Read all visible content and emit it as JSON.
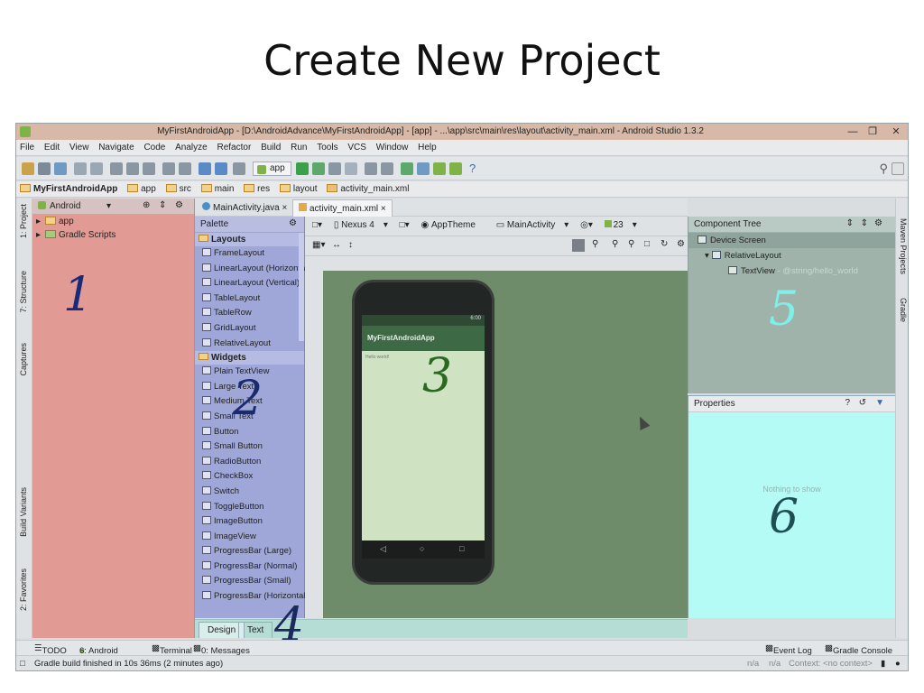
{
  "slide": {
    "title": "Create New Project"
  },
  "window": {
    "title": "MyFirstAndroidApp - [D:\\AndroidAdvance\\MyFirstAndroidApp] - [app] - ...\\app\\src\\main\\res\\layout\\activity_main.xml - Android Studio 1.3.2"
  },
  "menu": [
    "File",
    "Edit",
    "View",
    "Navigate",
    "Code",
    "Analyze",
    "Refactor",
    "Build",
    "Run",
    "Tools",
    "VCS",
    "Window",
    "Help"
  ],
  "toolbar": {
    "run_config": "app",
    "help": "?"
  },
  "breadcrumbs": [
    "MyFirstAndroidApp",
    "app",
    "src",
    "main",
    "res",
    "layout",
    "activity_main.xml"
  ],
  "left_tool_tabs": [
    "1: Project",
    "7: Structure",
    "Captures",
    "Build Variants",
    "2: Favorites"
  ],
  "right_tool_tabs": [
    "Maven Projects",
    "Gradle"
  ],
  "project": {
    "view": "Android",
    "items": [
      "app",
      "Gradle Scripts"
    ]
  },
  "editor_tabs": [
    "MainActivity.java",
    "activity_main.xml"
  ],
  "palette": {
    "title": "Palette",
    "groups": [
      {
        "name": "Layouts",
        "items": [
          "FrameLayout",
          "LinearLayout (Horizontal)",
          "LinearLayout (Vertical)",
          "TableLayout",
          "TableRow",
          "GridLayout",
          "RelativeLayout"
        ]
      },
      {
        "name": "Widgets",
        "items": [
          "Plain TextView",
          "Large Text",
          "Medium Text",
          "Small Text",
          "Button",
          "Small Button",
          "RadioButton",
          "CheckBox",
          "Switch",
          "ToggleButton",
          "ImageButton",
          "ImageView",
          "ProgressBar (Large)",
          "ProgressBar (Normal)",
          "ProgressBar (Small)",
          "ProgressBar (Horizontal)"
        ]
      }
    ]
  },
  "designer": {
    "device": "Nexus 4",
    "theme": "AppTheme",
    "activity": "MainActivity",
    "api": "23",
    "phone_time": "6:00",
    "app_title": "MyFirstAndroidApp",
    "hello_text": "Hello world!"
  },
  "design_tabs": [
    "Design",
    "Text"
  ],
  "component_tree": {
    "title": "Component Tree",
    "rows": [
      {
        "label": "Device Screen",
        "sub": ""
      },
      {
        "label": "RelativeLayout",
        "sub": ""
      },
      {
        "label": "TextView",
        "sub": " - @string/hello_world"
      }
    ]
  },
  "properties": {
    "title": "Properties",
    "empty": "Nothing to show",
    "help": "?"
  },
  "annotations": [
    "1",
    "2",
    "3",
    "4",
    "5",
    "6"
  ],
  "tool_windows": {
    "todo": "TODO",
    "android": "6: Android",
    "terminal": "Terminal",
    "messages": "0: Messages",
    "event_log": "Event Log",
    "gradle_console": "Gradle Console"
  },
  "status": {
    "message": "Gradle build finished in 10s 36ms (2 minutes ago)",
    "na1": "n/a",
    "na2": "n/a",
    "context": "Context: <no context>"
  },
  "colors": {
    "project_panel": "#e29a95",
    "palette_panel": "#9ea7d8",
    "canvas": "#6f8c6a",
    "component_tree": "#9fb3ab",
    "properties": "#b5fbf5",
    "design_tabs": "#b6dcd6"
  }
}
